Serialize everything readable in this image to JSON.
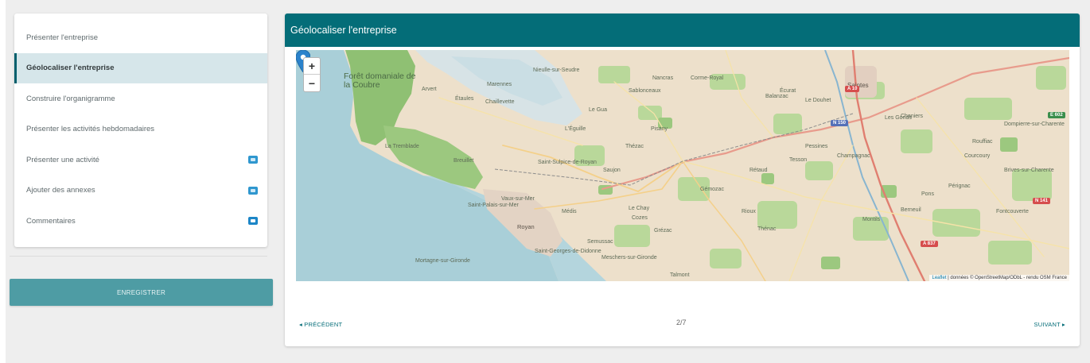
{
  "sidebar": {
    "items": [
      {
        "label": "Présenter l'entreprise"
      },
      {
        "label": "Géolocaliser l'entreprise"
      },
      {
        "label": "Construire l'organigramme"
      },
      {
        "label": "Présenter les activités hebdomadaires"
      },
      {
        "label": "Présenter une activité"
      },
      {
        "label": "Ajouter des annexes"
      },
      {
        "label": "Commentaires"
      }
    ],
    "save_label": "ENREGISTRER"
  },
  "main": {
    "title": "Géolocaliser l'entreprise",
    "map": {
      "zoom_in": "+",
      "zoom_out": "−",
      "forest_label": "Forêt domaniale de la Coubre",
      "labels": [
        "Saintes",
        "La Tremblade",
        "Royan",
        "Saujon",
        "Cozes",
        "Gémozac",
        "Pons",
        "Marennes",
        "Le Gua",
        "Meschers-sur-Gironde",
        "Saint-Georges-de-Didonne",
        "Saint-Palais-sur-Mer",
        "Vaux-sur-Mer",
        "Thénac",
        "Tesson",
        "Montils",
        "Le Chay",
        "Rioux",
        "Pisany",
        "Corme-Royal",
        "Berneuil",
        "Courcoury",
        "Brives-sur-Charente",
        "Dompierre-sur-Charente",
        "Chaniers",
        "Rouffiac",
        "Pérignac",
        "Les Gonds",
        "Le Douhet",
        "Champagnac",
        "Mortagne-sur-Gironde",
        "Semussac",
        "Talmont",
        "Balanzac",
        "Nieulle-sur-Seudre",
        "Chaillevette",
        "Arvert",
        "Étaules",
        "Breuillet",
        "L'Éguille",
        "Sablonceaux",
        "Nancras",
        "Thézac",
        "Saint-Sulpice-de-Royan",
        "Médis",
        "Grézac",
        "Rétaud",
        "Pessines",
        "Écurat",
        "Fontcouverte"
      ],
      "roads": [
        "A 10",
        "A 837",
        "N 150",
        "N 141",
        "E 602"
      ],
      "attribution_lib": "Leaflet",
      "attribution_text": " | données © OpenStreetMap/ODbL - rendu OSM France"
    },
    "pagination": {
      "prev_label": "◂ PRÉCÉDENT",
      "page": "2/7",
      "next_label": "SUIVANT ▸"
    }
  },
  "colors": {
    "header": "#046d78",
    "active_item_bg": "#d6e6ea",
    "save_button": "#4e9ca4",
    "badge": "#2f97cf"
  },
  "icons": {
    "badge": "chat-bubble-icon",
    "marker": "map-marker-icon"
  }
}
